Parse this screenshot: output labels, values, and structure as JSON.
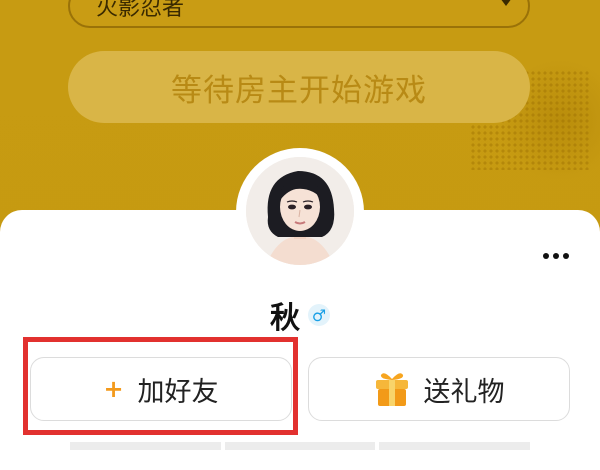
{
  "background": {
    "game_select_value": "火影忍者",
    "wait_button_label": "等待房主开始游戏"
  },
  "profile": {
    "nickname": "秋",
    "gender_symbol": "♂"
  },
  "actions": {
    "add_friend_icon": "+",
    "add_friend_label": "加好友",
    "send_gift_label": "送礼物"
  },
  "colors": {
    "overlay_gold": "#c89a10",
    "accent_orange": "#f39a1c",
    "highlight_red": "#e2312f",
    "male_blue": "#1aa0e6"
  },
  "icons": [
    "chevron-down-icon",
    "more-options-icon",
    "male-gender-icon",
    "plus-icon",
    "gift-icon"
  ]
}
